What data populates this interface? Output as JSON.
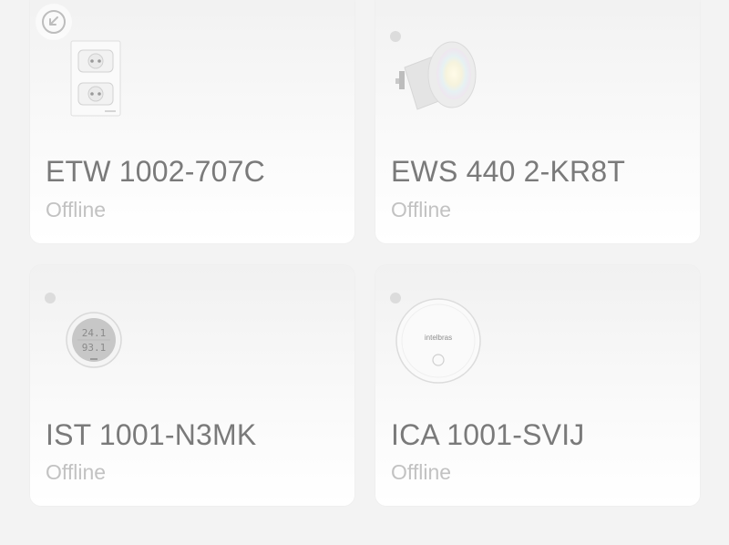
{
  "devices": [
    {
      "name": "ETW 1002-707C",
      "status": "Offline",
      "icon": "wall-outlet-icon"
    },
    {
      "name": "EWS 440 2-KR8T",
      "status": "Offline",
      "icon": "smart-bulb-icon"
    },
    {
      "name": "IST 1001-N3MK",
      "status": "Offline",
      "icon": "thermo-hygrometer-icon",
      "display": {
        "top": "24.1",
        "bottom": "93.1"
      }
    },
    {
      "name": "ICA 1001-SVIJ",
      "status": "Offline",
      "icon": "hub-icon",
      "brand": "intelbras"
    }
  ],
  "colors": {
    "background": "#f3f3f3",
    "name_text": "#7a7a7a",
    "status_text": "#c2c2c2",
    "status_dot": "#dcdcdc"
  }
}
